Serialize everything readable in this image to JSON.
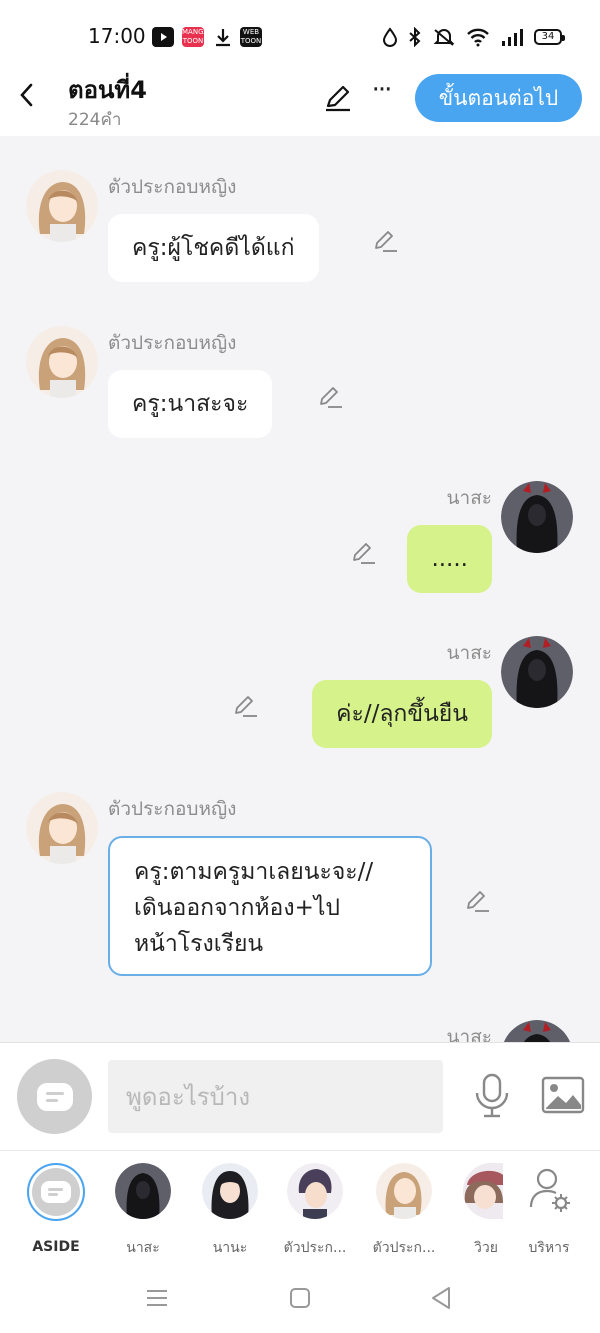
{
  "status_bar": {
    "time": "17:00",
    "apps": [
      "youtube-icon",
      "mangatoon-icon",
      "download-icon",
      "webtoon-icon"
    ],
    "app_texts": {
      "mangatoon": "MANGA TOON",
      "webtoon": "WEB TOON"
    },
    "battery": "34"
  },
  "header": {
    "title": "ตอนที่4",
    "word_count": "224คำ",
    "next_label": "ขั้นตอนต่อไป"
  },
  "messages": [
    {
      "side": "left",
      "sender": "ตัวประกอบหญิง",
      "text": "ครู:ผู้โชคดีได้แก่"
    },
    {
      "side": "left",
      "sender": "ตัวประกอบหญิง",
      "text": "ครู:นาสะจะ"
    },
    {
      "side": "right",
      "sender": "นาสะ",
      "text": "....."
    },
    {
      "side": "right",
      "sender": "นาสะ",
      "text": "ค่ะ//ลุกขึ้นยืน"
    },
    {
      "side": "left",
      "sender": "ตัวประกอบหญิง",
      "text": "ครู:ตามครูมาเลยนะจะ// เดินออกจากห้อง+ไป หน้าโรงเรียน",
      "lines": [
        "ครู:ตามครูมาเลยนะจะ//",
        "เดินออกจากห้อง+ไป",
        "หน้าโรงเรียน"
      ]
    },
    {
      "side": "right",
      "sender": "นาสะ",
      "text": ""
    }
  ],
  "input": {
    "placeholder": "พูดอะไรบ้าง"
  },
  "characters": [
    {
      "label": "ASIDE"
    },
    {
      "label": "นาสะ"
    },
    {
      "label": "นานะ"
    },
    {
      "label": "ตัวประก..."
    },
    {
      "label": "ตัวประก..."
    },
    {
      "label": "วิวย"
    },
    {
      "label": "บริหาร"
    }
  ],
  "colors": {
    "accent": "#4aa5f0",
    "right_bubble": "#d6f28a",
    "chat_bg": "#f4f4f6"
  }
}
